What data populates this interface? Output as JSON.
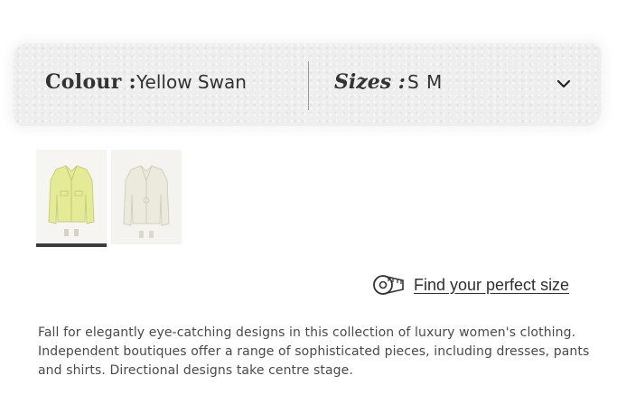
{
  "options": {
    "colour_label": "Colour :",
    "colour_value": "Yellow Swan",
    "sizes_label": "Sizes :",
    "sizes_value": "S M",
    "dropdown_icon": "chevron-down-icon"
  },
  "gallery": {
    "active_index": 0,
    "thumbnails": [
      {
        "alt": "Yellow cropped jacket",
        "color": "#e6ec9c"
      },
      {
        "alt": "Cream cropped jacket",
        "color": "#ecece0"
      }
    ]
  },
  "size_guide": {
    "icon": "measuring-tape-icon",
    "link_text": "Find your perfect size"
  },
  "description": "Fall for elegantly eye-catching designs in this collection of luxury women's clothing. Independent boutiques offer a range of sophisticated pieces, including dresses, pants and shirts. Directional designs take centre stage."
}
